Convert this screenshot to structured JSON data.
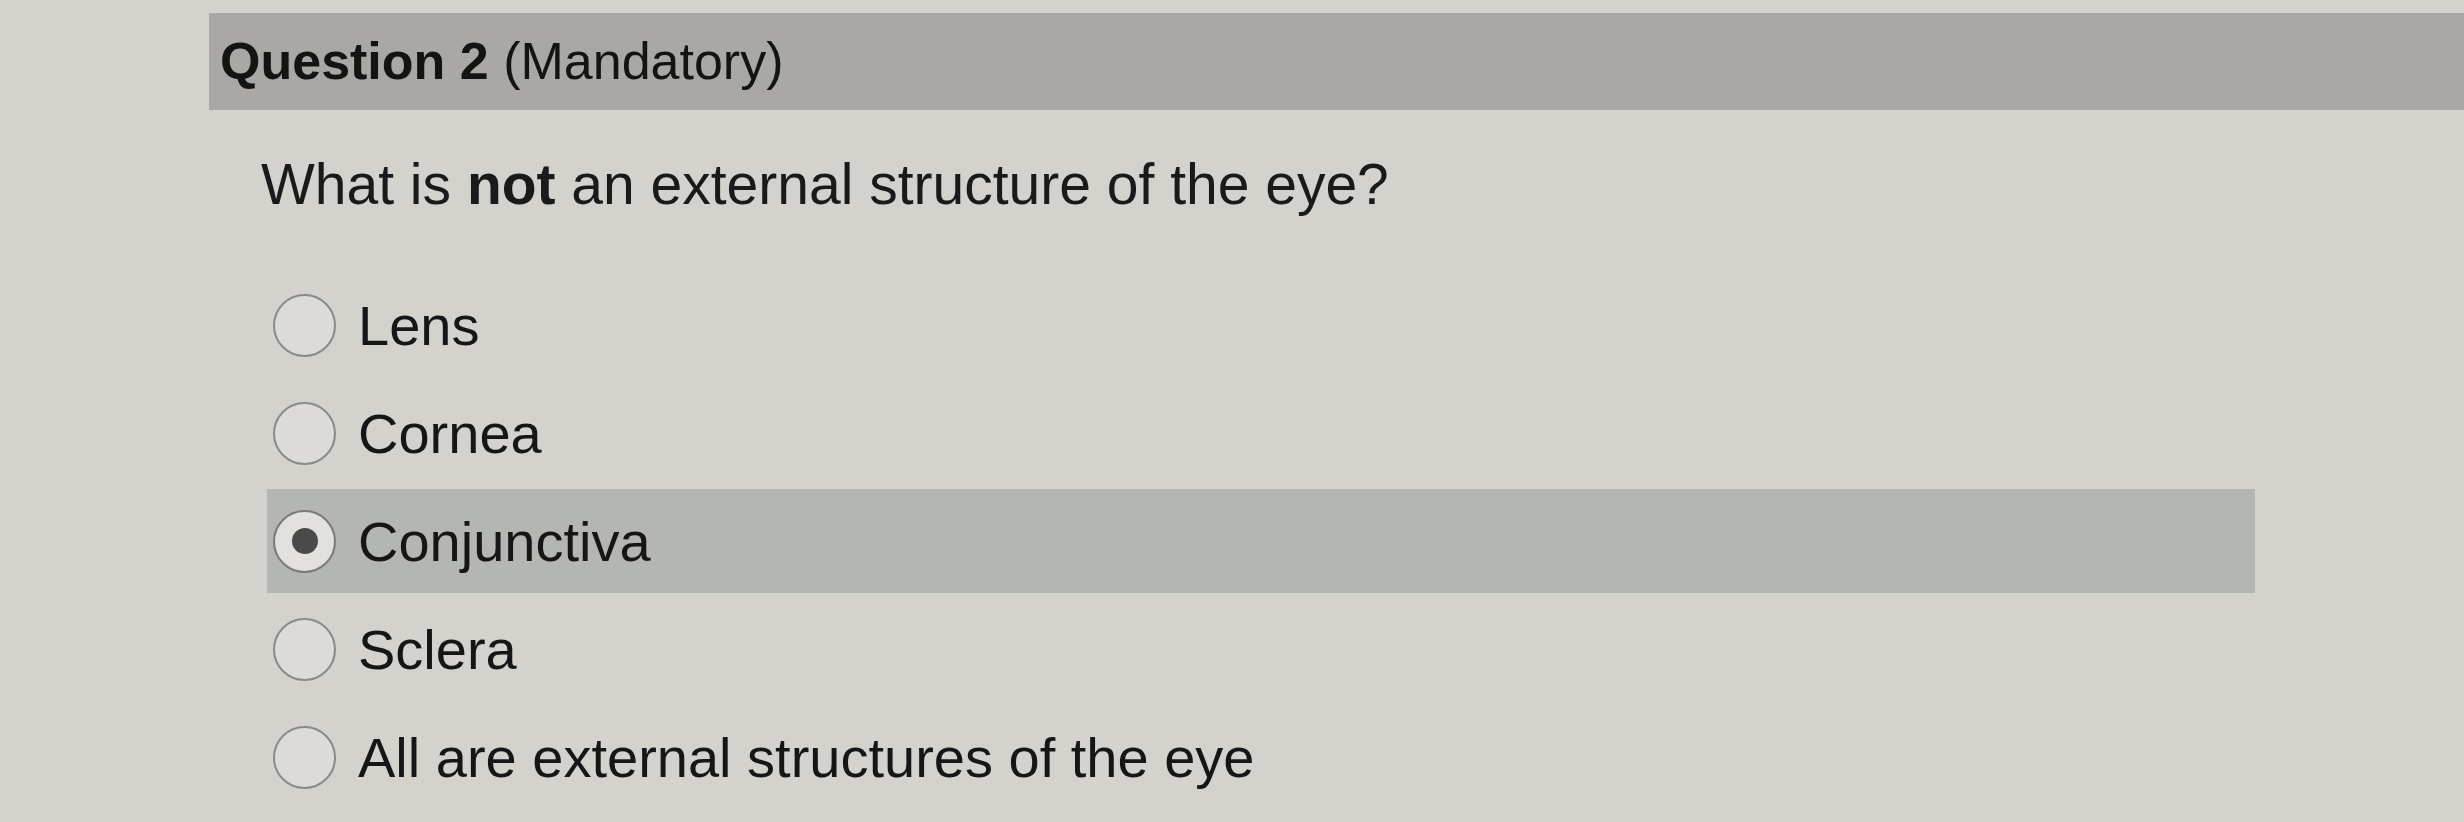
{
  "header": {
    "title": "**Question 2** (Mandatory)"
  },
  "question": {
    "text": "What is **not** an external structure of the eye?"
  },
  "options": [
    {
      "label": "Lens",
      "selected": false
    },
    {
      "label": "Cornea",
      "selected": false
    },
    {
      "label": "Conjunctiva",
      "selected": true
    },
    {
      "label": "Sclera",
      "selected": false
    },
    {
      "label": "All are external structures of the eye",
      "selected": false
    }
  ]
}
